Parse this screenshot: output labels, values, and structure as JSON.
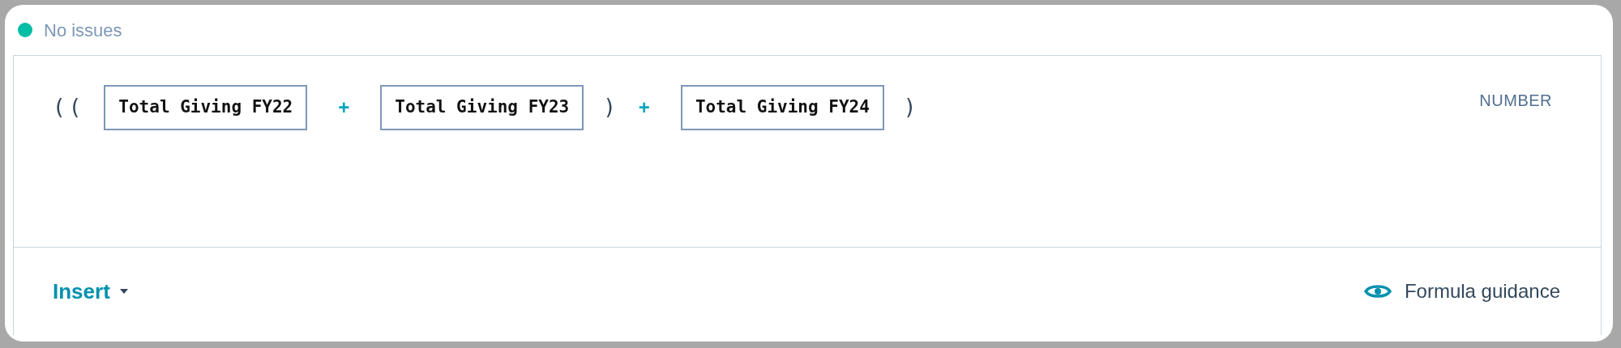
{
  "status": {
    "text": "No issues",
    "color": "#00bda5"
  },
  "formula": [
    {
      "kind": "paren",
      "text": "(("
    },
    {
      "kind": "token",
      "text": "Total Giving FY22"
    },
    {
      "kind": "operator",
      "text": "+"
    },
    {
      "kind": "token",
      "text": "Total Giving FY23"
    },
    {
      "kind": "paren",
      "text": ")"
    },
    {
      "kind": "operator",
      "text": "+"
    },
    {
      "kind": "token",
      "text": "Total Giving FY24"
    },
    {
      "kind": "paren",
      "text": ")"
    }
  ],
  "result_type": "NUMBER",
  "footer": {
    "insert_label": "Insert",
    "guidance_label": "Formula guidance"
  }
}
